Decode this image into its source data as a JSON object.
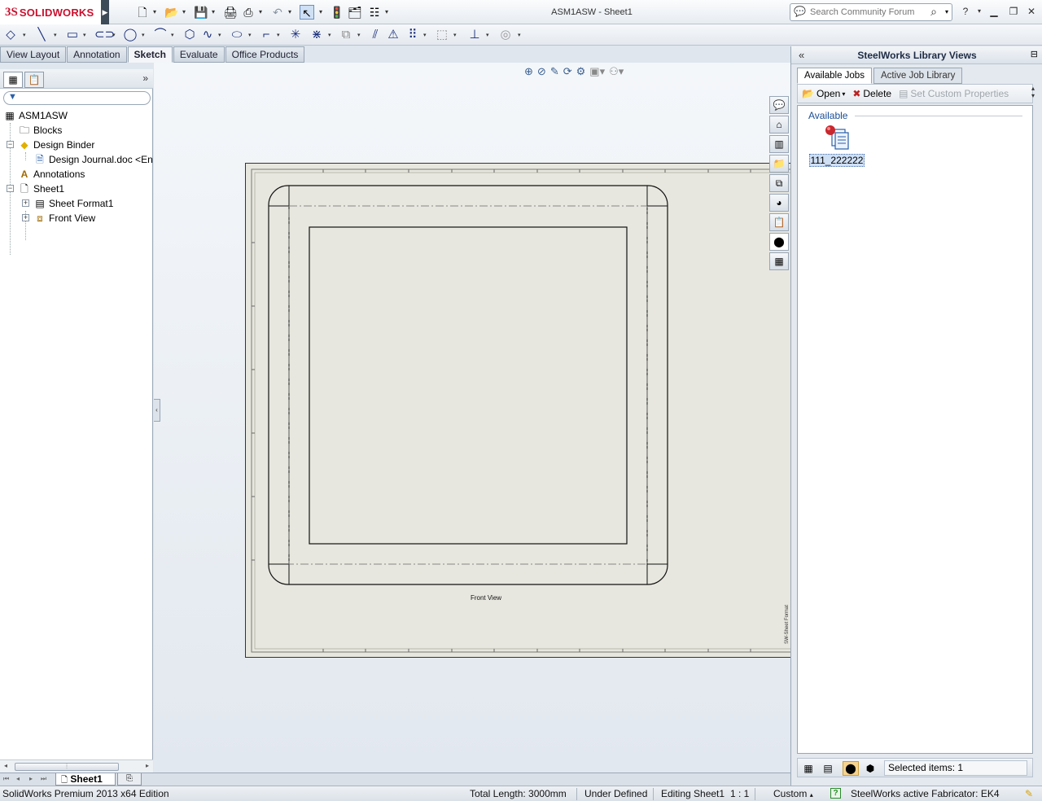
{
  "app": {
    "brand": "SOLIDWORKS",
    "document_title": "ASM1ASW - Sheet1"
  },
  "search": {
    "placeholder": "Search Community Forum",
    "value": "Search Community Forum"
  },
  "command_tabs": [
    {
      "label": "View Layout",
      "active": false
    },
    {
      "label": "Annotation",
      "active": false
    },
    {
      "label": "Sketch",
      "active": true
    },
    {
      "label": "Evaluate",
      "active": false
    },
    {
      "label": "Office Products",
      "active": false
    }
  ],
  "feature_tree": {
    "items": [
      {
        "label": "ASM1ASW",
        "icon": "assembly-drawing-icon"
      },
      {
        "label": "Blocks",
        "icon": "blocks-folder-icon"
      },
      {
        "label": "Design Binder",
        "icon": "design-binder-icon"
      },
      {
        "label": "Design Journal.doc <En",
        "icon": "word-document-icon"
      },
      {
        "label": "Annotations",
        "icon": "annotations-icon"
      },
      {
        "label": "Sheet1",
        "icon": "sheet-icon"
      },
      {
        "label": "Sheet Format1",
        "icon": "sheet-format-icon"
      },
      {
        "label": "Front View",
        "icon": "drawing-view-icon"
      }
    ]
  },
  "drawing": {
    "view_label": "Front View",
    "title_block_text": "SW-Sheet Format"
  },
  "right_panel": {
    "title": "SteelWorks Library Views",
    "tabs": [
      {
        "label": "Available Jobs",
        "active": true
      },
      {
        "label": "Active Job Library",
        "active": false
      }
    ],
    "toolbar": {
      "open_label": "Open",
      "delete_label": "Delete",
      "set_props_label": "Set Custom Properties"
    },
    "group_label": "Available",
    "job_item": "111_222222",
    "selected_items": "Selected items: 1"
  },
  "sheet_tabs": {
    "active": "Sheet1"
  },
  "status_bar": {
    "edition": "SolidWorks Premium 2013 x64 Edition",
    "total_length": "Total Length: 3000mm",
    "definition": "Under Defined",
    "editing": "Editing Sheet1",
    "scale": "1 : 1",
    "units": "Custom",
    "fabricator": "SteelWorks active Fabricator: EK4"
  },
  "colors": {
    "brand_red": "#c8102e",
    "sheet_bg": "#e8e7df",
    "selection_blue": "#cfe0f5",
    "link_blue": "#1a4d96"
  }
}
